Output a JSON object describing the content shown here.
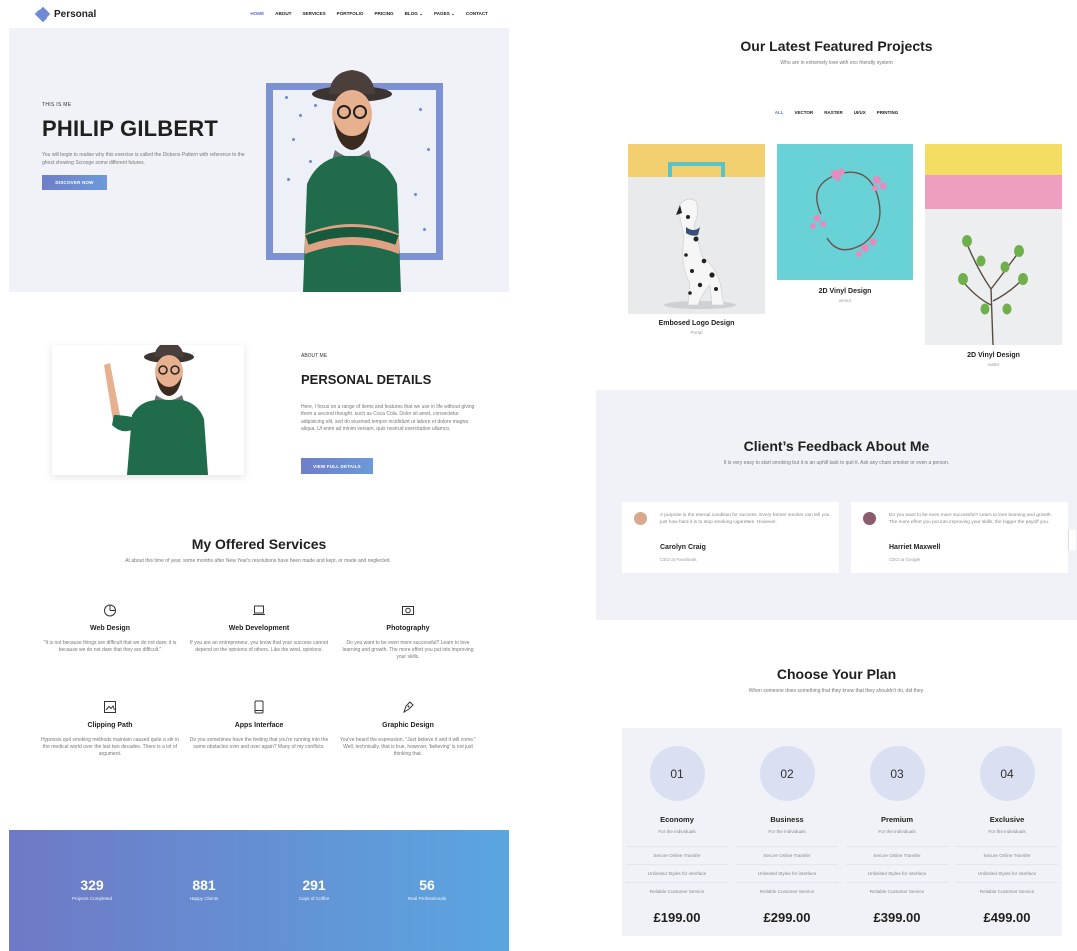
{
  "nav": {
    "brand": "Personal",
    "items": [
      "HOME",
      "ABOUT",
      "SERVICES",
      "PORTFOLIO",
      "PRICING",
      "BLOG ⌄",
      "PAGES ⌄",
      "CONTACT"
    ]
  },
  "hero": {
    "eyebrow": "THIS IS ME",
    "name": "PHILIP GILBERT",
    "text": "You will begin to realise why this exercise is called the Dickens Pattern with reference to the ghost showing Scrooge some different futures.",
    "button": "DISCOVER NOW"
  },
  "about": {
    "eyebrow": "ABOUT ME",
    "title": "PERSONAL DETAILS",
    "text": "Here, I focus on a range of items and features that we use in life without giving them a second thought. such as Coca Cola. Dolor sit amet, consectetur adipisicing elit, sed do eiusmod tempor incididunt ut labore et dolore magna aliqua. Ut enim ad minim veniam, quis nostrud exercitation ullamco.",
    "button": "VIEW FULL DETAILS"
  },
  "services": {
    "title": "My Offered Services",
    "subtitle": "At about this time of year, some months after New Year's resolutions have been made and kept, or made and neglected.",
    "items": [
      {
        "icon": "pie-chart-icon",
        "title": "Web Design",
        "text": "\"It is not because things are difficult that we do not dare; it is because we do not dare that they are difficult.\""
      },
      {
        "icon": "laptop-icon",
        "title": "Web Development",
        "text": "If you are an entrepreneur, you know that your success cannot depend on the opinions of others. Like the wind, opinions."
      },
      {
        "icon": "camera-icon",
        "title": "Photography",
        "text": "Do you want to be even more successful? Learn to love learning and growth. The more effort you put into improving your skills."
      },
      {
        "icon": "image-icon",
        "title": "Clipping Path",
        "text": "Hypnosis quit smoking methods maintain caused quite a stir in the medical world over the last two decades. There is a lot of argument."
      },
      {
        "icon": "tablet-icon",
        "title": "Apps Interface",
        "text": "Do you sometimes have the feeling that you're running into the same obstacles over and over again? Many of my conflicts."
      },
      {
        "icon": "pen-nib-icon",
        "title": "Graphic Design",
        "text": "You've heard the expression, \"Just believe it and it will come.\" Well, technically, that is true, however, 'believing' is not just thinking that."
      }
    ]
  },
  "stats": [
    {
      "value": "329",
      "label": "Projects Completed"
    },
    {
      "value": "881",
      "label": "Happy Clients"
    },
    {
      "value": "291",
      "label": "Cups of Coffee"
    },
    {
      "value": "56",
      "label": "Real Professionals"
    }
  ],
  "projects": {
    "title": "Our Latest Featured Projects",
    "subtitle": "Who are in extremely love with eco friendly system",
    "filters": [
      "ALL",
      "VECTOR",
      "RASTER",
      "UI/UX",
      "PRINTING"
    ],
    "cards": [
      {
        "title": "Embosed Logo Design",
        "sub": "Portal"
      },
      {
        "title": "2D Vinyl Design",
        "sub": "vector"
      },
      {
        "title": "2D Vinyl Design",
        "sub": "raster"
      }
    ]
  },
  "feedback": {
    "title": "Client’s Feedback About Me",
    "subtitle": "It is very easy to start smoking but it is an uphill task to quit it. Ask any chain smoker or even a person.",
    "items": [
      {
        "text": "A purpose is the eternal condition for success. Every former smoker can tell you just how hard it is to stop smoking cigarettes. However.",
        "name": "Carolyn Craig",
        "role": "CEO at Facebook"
      },
      {
        "text": "Do you want to be even more successful? Learn to love learning and growth. The more effort you put into improving your skills, the bigger the payoff you.",
        "name": "Harriet Maxwell",
        "role": "CEO at Google"
      }
    ]
  },
  "pricing": {
    "title": "Choose Your Plan",
    "subtitle": "When someone does something that they know that they shouldn't do, did they.",
    "plans": [
      {
        "num": "01",
        "name": "Economy",
        "for": "For the individuals",
        "features": [
          "Secure Online Transfer",
          "Unlimited Styles for interface",
          "Reliable Customer Service"
        ],
        "price": "£199.00"
      },
      {
        "num": "02",
        "name": "Business",
        "for": "For the individuals",
        "features": [
          "Secure Online Transfer",
          "Unlimited Styles for interface",
          "Reliable Customer Service"
        ],
        "price": "£299.00"
      },
      {
        "num": "03",
        "name": "Premium",
        "for": "For the individuals",
        "features": [
          "Secure Online Transfer",
          "Unlimited Styles for interface",
          "Reliable Customer Service"
        ],
        "price": "£399.00"
      },
      {
        "num": "04",
        "name": "Exclusive",
        "for": "For the individuals",
        "features": [
          "Secure Online Transfer",
          "Unlimited Styles for interface",
          "Reliable Customer Service"
        ],
        "price": "£499.00"
      }
    ]
  },
  "colors": {
    "accent": "#6f7ec9",
    "section_bg": "#f1f2f7",
    "gradient_end": "#5aa6e0"
  }
}
